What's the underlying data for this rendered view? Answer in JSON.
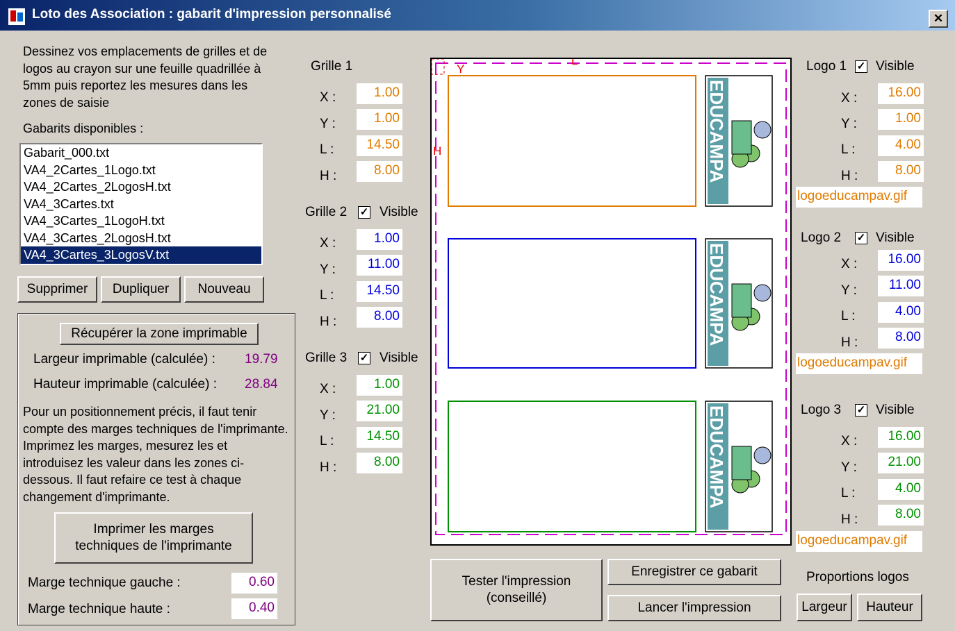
{
  "window": {
    "title": "Loto des Association : gabarit d'impression personnalisé",
    "close_glyph": "✕"
  },
  "intro": {
    "text": "Dessinez vos emplacements de grilles et de logos au crayon sur une feuille quadrillée à 5mm puis reportez les mesures dans les zones de saisie"
  },
  "templates": {
    "label": "Gabarits disponibles :",
    "items": [
      "Gabarit_000.txt",
      "VA4_2Cartes_1Logo.txt",
      "VA4_2Cartes_2LogosH.txt",
      "VA4_3Cartes.txt",
      "VA4_3Cartes_1LogoH.txt",
      "VA4_3Cartes_2LogosH.txt",
      "VA4_3Cartes_3LogosV.txt"
    ],
    "selected_index": 6
  },
  "buttons": {
    "delete": "Supprimer",
    "duplicate": "Dupliquer",
    "new": "Nouveau",
    "retrieve_zone": "Récupérer la zone imprimable",
    "print_margins": "Imprimer les marges techniques de l'imprimante",
    "test_print": "Tester l'impression (conseillé)",
    "save_template": "Enregistrer ce gabarit",
    "launch_print": "Lancer l'impression",
    "width": "Largeur",
    "height": "Hauteur"
  },
  "printable": {
    "width_label": "Largeur imprimable (calculée) :",
    "width_value": "19.79",
    "height_label": "Hauteur imprimable (calculée) :",
    "height_value": "28.84",
    "note": "Pour un positionnement précis, il faut tenir compte des marges techniques de l'imprimante. Imprimez les marges, mesurez les et introduisez les valeur dans les zones ci-dessous. Il faut refaire ce test à chaque changement d'imprimante.",
    "margin_left_label": "Marge technique gauche :",
    "margin_left_value": "0.60",
    "margin_top_label": "Marge technique haute :",
    "margin_top_value": "0.40"
  },
  "field_labels": {
    "x": "X :",
    "y": "Y :",
    "l": "L :",
    "h": "H :"
  },
  "visible_label": "Visible",
  "grids": [
    {
      "title": "Grille 1",
      "x": "1.00",
      "y": "1.00",
      "l": "14.50",
      "h": "8.00",
      "color": "#e07b00"
    },
    {
      "title": "Grille 2",
      "visible": true,
      "x": "1.00",
      "y": "11.00",
      "l": "14.50",
      "h": "8.00",
      "color": "#0000dd"
    },
    {
      "title": "Grille 3",
      "visible": true,
      "x": "1.00",
      "y": "21.00",
      "l": "14.50",
      "h": "8.00",
      "color": "#009000"
    }
  ],
  "logos": [
    {
      "title": "Logo 1",
      "visible": true,
      "x": "16.00",
      "y": "1.00",
      "l": "4.00",
      "h": "8.00",
      "file": "logoeducampav.gif"
    },
    {
      "title": "Logo 2",
      "visible": true,
      "x": "16.00",
      "y": "11.00",
      "l": "4.00",
      "h": "8.00",
      "file": "logoeducampav.gif"
    },
    {
      "title": "Logo 3",
      "visible": true,
      "x": "16.00",
      "y": "21.00",
      "l": "4.00",
      "h": "8.00",
      "file": "logoeducampav.gif"
    }
  ],
  "preview": {
    "logo_text": "EDUCAMPA",
    "marker_y": "Y",
    "marker_l": "L",
    "marker_h": "H",
    "margin_color": "#cc00cc"
  },
  "logo_proportions": {
    "label": "Proportions logos"
  }
}
